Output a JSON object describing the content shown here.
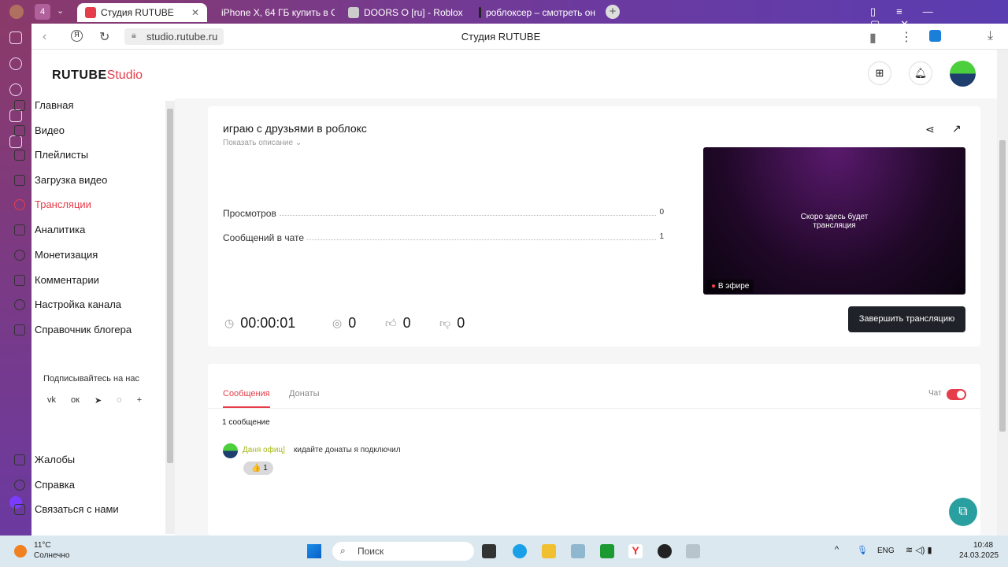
{
  "browser": {
    "tab_count": "4",
    "tabs": [
      {
        "label": "Студия RUTUBE",
        "active": true
      },
      {
        "label": "iPhone X, 64 ГБ купить в С"
      },
      {
        "label": "DOORS ⭘ [ru] - Roblox"
      },
      {
        "label": "роблоксер – смотреть он"
      }
    ],
    "url": "studio.rutube.ru",
    "page_title": "Студия RUTUBE"
  },
  "header": {
    "logo_main": "RUTUBE",
    "logo_sub": "Studio"
  },
  "sidebar": {
    "items": [
      {
        "label": "Главная"
      },
      {
        "label": "Видео"
      },
      {
        "label": "Плейлисты"
      },
      {
        "label": "Загрузка видео"
      },
      {
        "label": "Трансляции",
        "active": true
      },
      {
        "label": "Аналитика"
      },
      {
        "label": "Монетизация"
      },
      {
        "label": "Комментарии"
      },
      {
        "label": "Настройка канала"
      },
      {
        "label": "Справочник блогера"
      }
    ],
    "subscribe_label": "Подписывайтесь на нас",
    "social": [
      "vk",
      "ok",
      "telegram",
      "viber",
      "+"
    ],
    "bottom": [
      {
        "label": "Жалобы"
      },
      {
        "label": "Справка"
      },
      {
        "label": "Связаться с нами"
      }
    ]
  },
  "stream": {
    "title": "играю с друзьями в роблокс",
    "show_description": "Показать описание",
    "stats": [
      {
        "label": "Просмотров",
        "value": "0"
      },
      {
        "label": "Сообщений в чате",
        "value": "1"
      }
    ],
    "duration": "00:00:01",
    "viewers": "0",
    "likes": "0",
    "dislikes": "0",
    "preview_text": "Скоро здесь будет трансляция",
    "live_badge": "В эфире",
    "end_button": "Завершить трансляцию"
  },
  "chat": {
    "tabs": [
      {
        "label": "Сообщения",
        "active": true
      },
      {
        "label": "Донаты"
      }
    ],
    "toggle_label": "Чат",
    "toggle_on": true,
    "count_label": "1 сообщение",
    "messages": [
      {
        "author": "Даня офиц]",
        "text": "кидайте донаты я подключил",
        "reaction": "👍",
        "reaction_count": "1"
      }
    ]
  },
  "taskbar": {
    "weather_temp": "11°C",
    "weather_desc": "Солнечно",
    "search": "Поиск",
    "lang": "ENG",
    "time": "10:48",
    "date": "24.03.2025"
  },
  "colors": {
    "accent": "#e63d4b",
    "dark_button": "#1f2228"
  }
}
